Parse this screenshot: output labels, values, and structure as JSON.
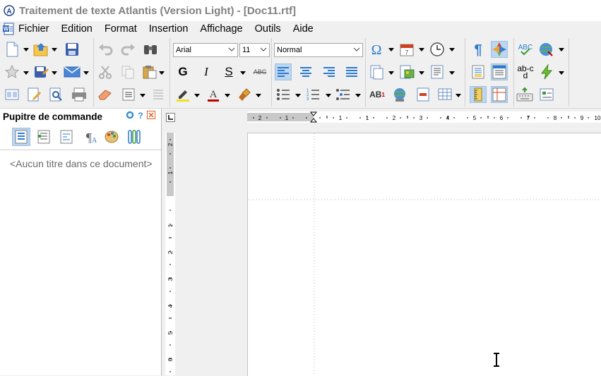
{
  "window": {
    "title": "Traitement de texte Atlantis (Version Light) - [Doc11.rtf]"
  },
  "menu": {
    "items": [
      "Fichier",
      "Edition",
      "Format",
      "Insertion",
      "Affichage",
      "Outils",
      "Aide"
    ]
  },
  "toolbar": {
    "font_name": "Arial",
    "font_size": "11",
    "style_name": "Normal",
    "bold_label": "G",
    "italic_label": "I",
    "underline_label": "S",
    "strike_label": "ABC",
    "spell_label": "ABC",
    "replace_label": "ab-cd",
    "superscript_label": "AB"
  },
  "panel": {
    "title": "Pupitre de commande",
    "empty_text": "<Aucun titre dans ce document>"
  },
  "ruler": {
    "h_labels": [
      "2",
      "1",
      "1",
      "1",
      "2",
      "3",
      "4",
      "5",
      "6",
      "7",
      "8",
      "9",
      "10"
    ],
    "v_labels": [
      "2",
      "1",
      "1",
      "2",
      "3",
      "4",
      "5",
      "6"
    ]
  },
  "colors": {
    "accent": "#2b79d0",
    "pressed": "#bcd6f0",
    "text_gray": "#808080"
  }
}
